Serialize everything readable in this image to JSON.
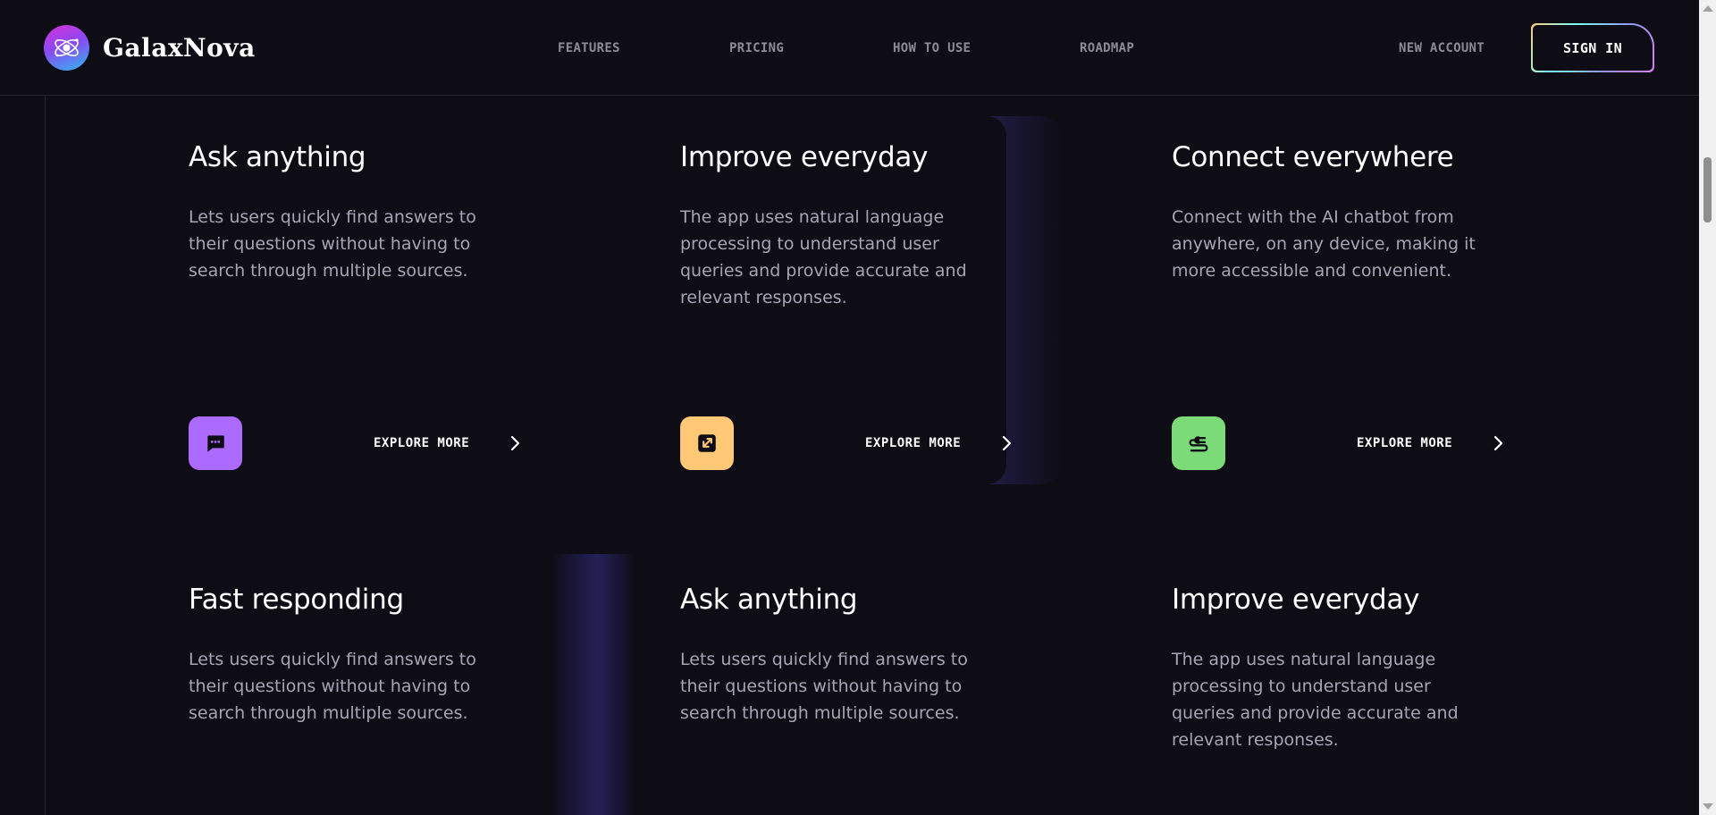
{
  "brand": {
    "name": "GalaxNova",
    "icon": "galaxy-logo-icon"
  },
  "nav": {
    "items": [
      "FEATURES",
      "PRICING",
      "HOW TO USE",
      "ROADMAP"
    ],
    "new_account": "NEW ACCOUNT",
    "sign_in": "SIGN IN"
  },
  "cards": [
    {
      "title": "Ask anything",
      "text": "Lets users quickly find answers to their questions without having to search through multiple sources.",
      "icon": "chat-bubble-icon",
      "icon_color": "#ac6aff",
      "cta": "EXPLORE MORE"
    },
    {
      "title": "Improve everyday",
      "text": "The app uses natural language processing to understand user queries and provide accurate and relevant responses.",
      "icon": "expand-arrow-icon",
      "icon_color": "#ffc876",
      "cta": "EXPLORE MORE"
    },
    {
      "title": "Connect everywhere",
      "text": "Connect with the AI chatbot from anywhere, on any device, making it more accessible and convenient.",
      "icon": "plug-icon",
      "icon_color": "#7adb78",
      "cta": "EXPLORE MORE"
    },
    {
      "title": "Fast responding",
      "text": "Lets users quickly find answers to their questions without having to search through multiple sources."
    },
    {
      "title": "Ask anything",
      "text": "Lets users quickly find answers to their questions without having to search through multiple sources."
    },
    {
      "title": "Improve everyday",
      "text": "The app uses natural language processing to understand user queries and provide accurate and relevant responses."
    }
  ],
  "colors": {
    "background": "#0e0c15",
    "text_primary": "#fefefe",
    "text_muted": "#a7a4b4",
    "nav_text": "#8e8b98"
  }
}
